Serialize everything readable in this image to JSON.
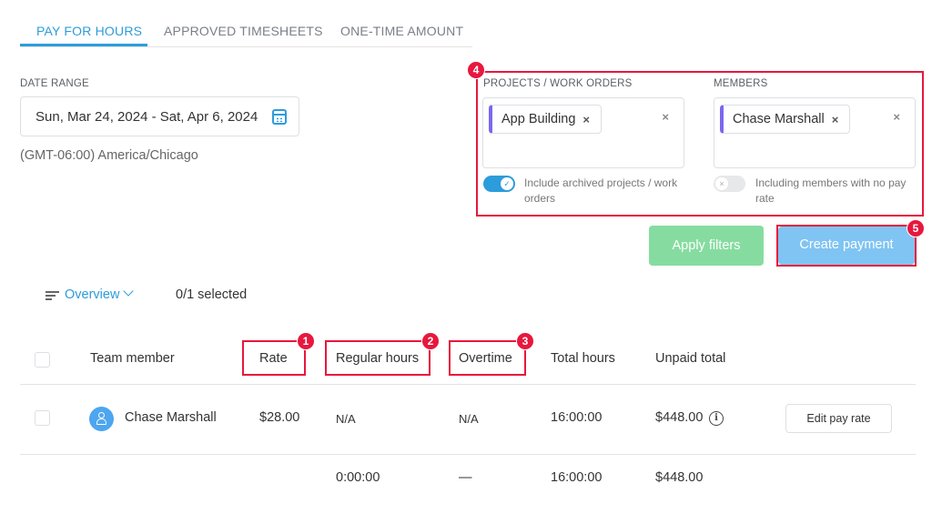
{
  "tabs": [
    {
      "label": "PAY FOR HOURS",
      "active": true
    },
    {
      "label": "APPROVED TIMESHEETS",
      "active": false
    },
    {
      "label": "ONE-TIME AMOUNT",
      "active": false
    }
  ],
  "date_range": {
    "label": "DATE RANGE",
    "value": "Sun, Mar 24, 2024 - Sat, Apr 6, 2024",
    "timezone": "(GMT-06:00) America/Chicago"
  },
  "filters": {
    "projects": {
      "label": "PROJECTS / WORK ORDERS",
      "chip": "App Building",
      "toggle_on": true,
      "toggle_line1": "Include archived projects / work",
      "toggle_line2": "orders"
    },
    "members": {
      "label": "MEMBERS",
      "chip": "Chase Marshall",
      "toggle_on": false,
      "toggle_line1": "Including members with no pay",
      "toggle_line2": "rate"
    }
  },
  "buttons": {
    "apply": "Apply filters",
    "create": "Create payment",
    "edit_pay_rate": "Edit pay rate"
  },
  "overview": {
    "label": "Overview",
    "selected": "0/1 selected"
  },
  "table": {
    "headers": [
      "Team member",
      "Rate",
      "Regular hours",
      "Overtime",
      "Total hours",
      "Unpaid total"
    ],
    "row": {
      "member": "Chase Marshall",
      "rate": "$28.00",
      "regular_hours": "N/A",
      "overtime": "N/A",
      "total_hours": "16:00:00",
      "unpaid_total": "$448.00"
    },
    "totals": {
      "regular_hours": "0:00:00",
      "overtime": "—",
      "total_hours": "16:00:00",
      "unpaid_total": "$448.00"
    }
  },
  "annotations": [
    "1",
    "2",
    "3",
    "4",
    "5"
  ],
  "icons": {
    "calendar": "calendar-icon",
    "info": "i",
    "remove": "×",
    "check": "✓",
    "toggle_off_mark": "×"
  },
  "colors": {
    "accent": "#2d9cdb",
    "annotation": "#e8173d",
    "apply_button": "#86dca0",
    "create_button": "#7fc4f2",
    "chip_marker": "#7b68ee"
  }
}
